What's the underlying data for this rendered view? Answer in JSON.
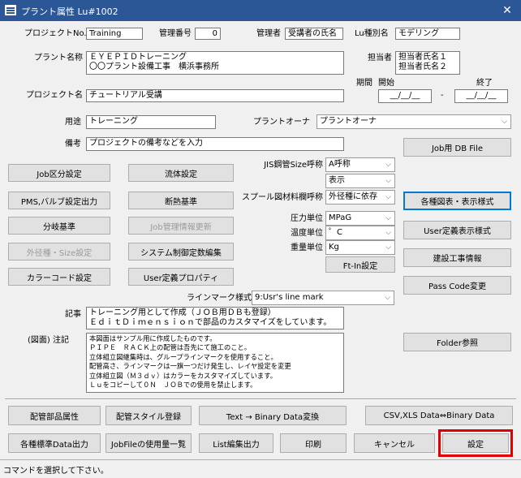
{
  "window": {
    "title": "プラント属性 Lu#1002",
    "close": "✕"
  },
  "header": {
    "project_no_label": "プロジェクトNo.",
    "project_no": "Training",
    "mgmt_no_label": "管理番号",
    "mgmt_no": "0",
    "manager_label": "管理者",
    "manager": "受講者の氏名",
    "lu_type_label": "Lu種別名",
    "lu_type": "モデリング"
  },
  "plant": {
    "name_label": "プラント名称",
    "name_lines": [
      "ＥＹＥＰＩＤトレーニング",
      "〇〇プラント設備工事　横浜事務所"
    ],
    "person_label": "担当者",
    "person_lines": [
      "担当者氏名１",
      "担当者氏名２"
    ],
    "period_label": "期間",
    "start_label": "開始",
    "end_label": "終了",
    "start_value": "__/__/__",
    "end_value": "__/__/__",
    "dash": "-",
    "project_name_label": "プロジェクト名",
    "project_name": "チュートリアル受講"
  },
  "usage": {
    "label": "用途",
    "value": "トレーニング"
  },
  "owner": {
    "label": "プラントオーナ",
    "value": "プラントオーナ"
  },
  "remarks": {
    "label": "備考",
    "value": "プロジェクトの備考などを入力"
  },
  "jobdb_button": "Job用 DB File",
  "left_buttons": [
    {
      "label": "Job区分設定",
      "enabled": true
    },
    {
      "label": "流体設定",
      "enabled": true
    },
    {
      "label": "PMS,バルブ設定出力",
      "enabled": true
    },
    {
      "label": "断熱基準",
      "enabled": true
    },
    {
      "label": "分岐基準",
      "enabled": true
    },
    {
      "label": "Job管理情報更新",
      "enabled": false
    },
    {
      "label": "外径種・Size設定",
      "enabled": false
    },
    {
      "label": "システム制御定数編集",
      "enabled": true
    },
    {
      "label": "カラーコード設定",
      "enabled": true
    },
    {
      "label": "User定義プロパティ",
      "enabled": true
    }
  ],
  "settings": {
    "jis_label": "JIS鋼管Size呼称",
    "jis_value": "A呼称",
    "display_value": "表示",
    "spool_label": "スプール図材料欄呼称",
    "spool_value": "外径種に依存",
    "pressure_label": "圧力単位",
    "pressure_value": "MPaG",
    "temp_label": "温度単位",
    "temp_value": "゜C",
    "weight_label": "重量単位",
    "weight_value": "Kg",
    "ftin_button": "Ft-In設定",
    "line_mark_label": "ラインマーク様式",
    "line_mark_value": "9:Usr's line mark"
  },
  "right_buttons": [
    "各種図表・表示様式",
    "User定義表示様式",
    "建設工事情報",
    "Pass Code変更"
  ],
  "article": {
    "label": "記事",
    "lines": [
      "トレーニング用として作成（ＪＯＢ用ＤＢも登録）",
      "ＥｄｉｔＤｉｍｅｎｓｉｏｎで部品のカスタマイズをしています。"
    ]
  },
  "note": {
    "label": "(図面) 注記",
    "lines": [
      "本図面はサンプル用に作成したものです。",
      "ＰＩＰＥ　ＲＡＣＫ上の配管は吾先にて施工のこと。",
      "立体組立図継集時は、グループラインマークを使用すること。",
      "配管高さ、ラインマークは一旗一つだけ発生し、レイヤ設定を変更",
      "立体組立図（Ｍ３ｄｖ）はカラーをカスタマイズしています。",
      "Ｌｕをコピーして０Ｎ　ＪＯＢでの使用を禁止します。"
    ]
  },
  "folder_button": "Folder参照",
  "bottom_row1": [
    "配管部品属性",
    "配管スタイル登録",
    "Text → Binary Data変換",
    "CSV,XLS Data⇔Binary Data"
  ],
  "bottom_row2": [
    "各種標準Data出力",
    "JobFileの使用量一覧",
    "List編集出力",
    "印刷",
    "キャンセル",
    "設定"
  ],
  "status": "コマンドを選択して下さい。",
  "colors": {
    "titlebar": "#2b5797",
    "highlight": "#e00000"
  }
}
